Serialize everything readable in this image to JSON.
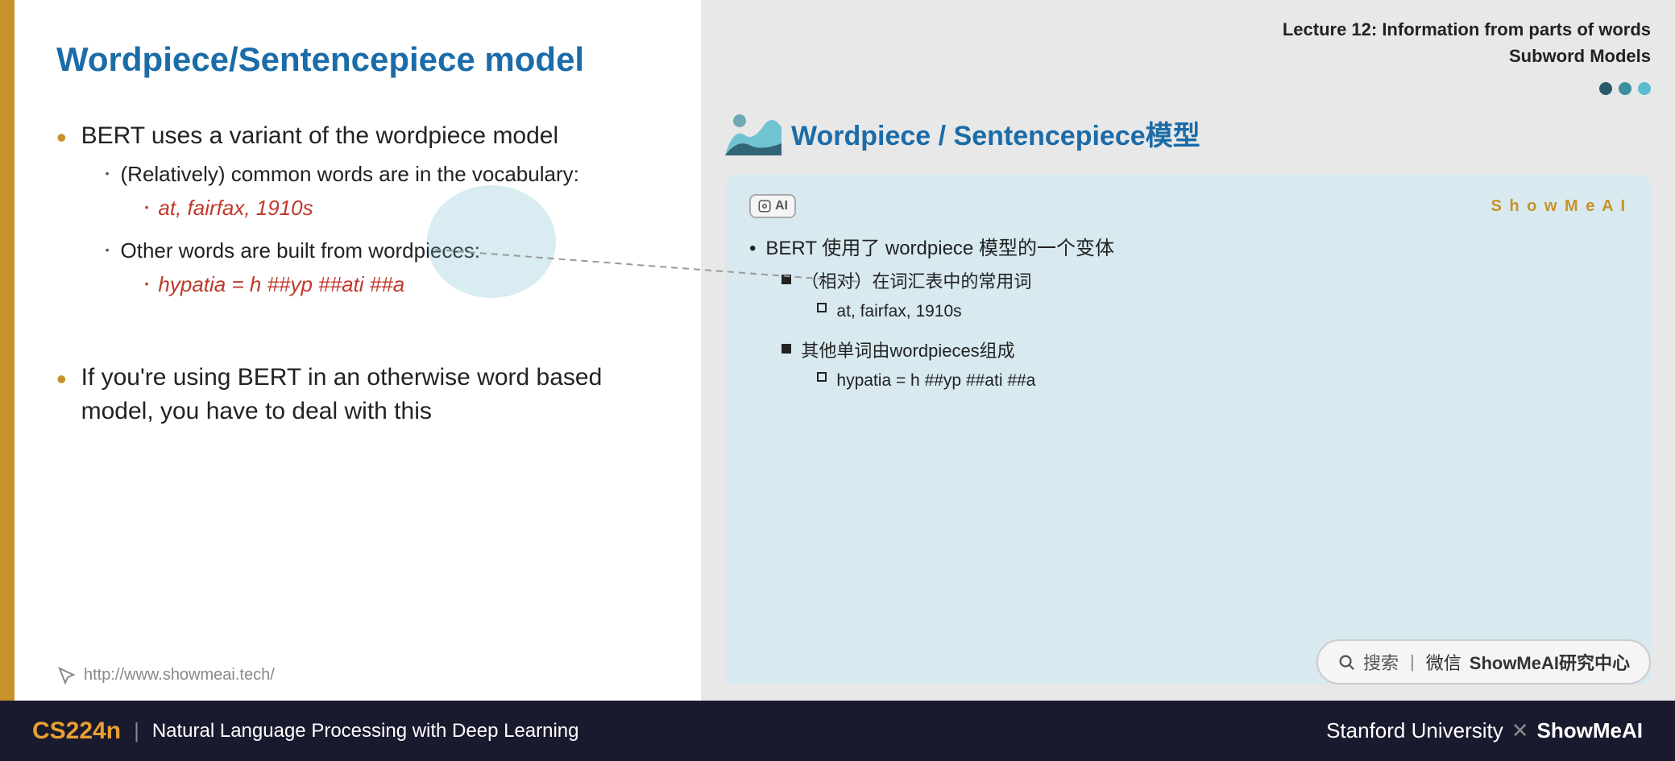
{
  "slide": {
    "title": "Wordpiece/Sentencepiece model",
    "left_border_color": "#c8922a",
    "bullets": [
      {
        "text": "BERT uses a variant of the wordpiece model",
        "sub_bullets": [
          {
            "text": "(Relatively) common words are in the vocabulary:",
            "sub_sub_bullets": [
              {
                "text": "at, fairfax, 1910s"
              }
            ]
          },
          {
            "text": "Other words are built from wordpieces:",
            "sub_sub_bullets": [
              {
                "text": "hypatia = h  ##yp  ##ati  ##a"
              }
            ]
          }
        ]
      },
      {
        "text": "If you're using BERT in an otherwise word based model, you have to deal with this",
        "sub_bullets": []
      }
    ],
    "footer_icon": "cursor-icon",
    "footer_url": "http://www.showmeai.tech/"
  },
  "right_panel": {
    "lecture_line1": "Lecture 12: Information from parts of words",
    "lecture_line2": "Subword Models",
    "title": "Wordpiece / Sentencepiece模型",
    "card": {
      "ai_badge": "AI",
      "showmeai_label": "S h o w M e A I",
      "main_bullet": "BERT 使用了 wordpiece 模型的一个变体",
      "sub_bullets": [
        {
          "text": "（相对）在词汇表中的常用词",
          "sub_sub": [
            {
              "text": "at, fairfax, 1910s"
            }
          ]
        },
        {
          "text": "其他单词由wordpieces组成",
          "sub_sub": [
            {
              "text": "hypatia = h ##yp ##ati ##a"
            }
          ]
        }
      ]
    },
    "search_placeholder": "搜索 | 微信 ShowMeAI研究中心"
  },
  "bottom_bar": {
    "course_code": "CS224n",
    "divider": "|",
    "course_name": "Natural Language Processing with Deep Learning",
    "right_text_1": "Stanford University",
    "right_x": "✕",
    "right_text_2": "ShowMeAI"
  }
}
